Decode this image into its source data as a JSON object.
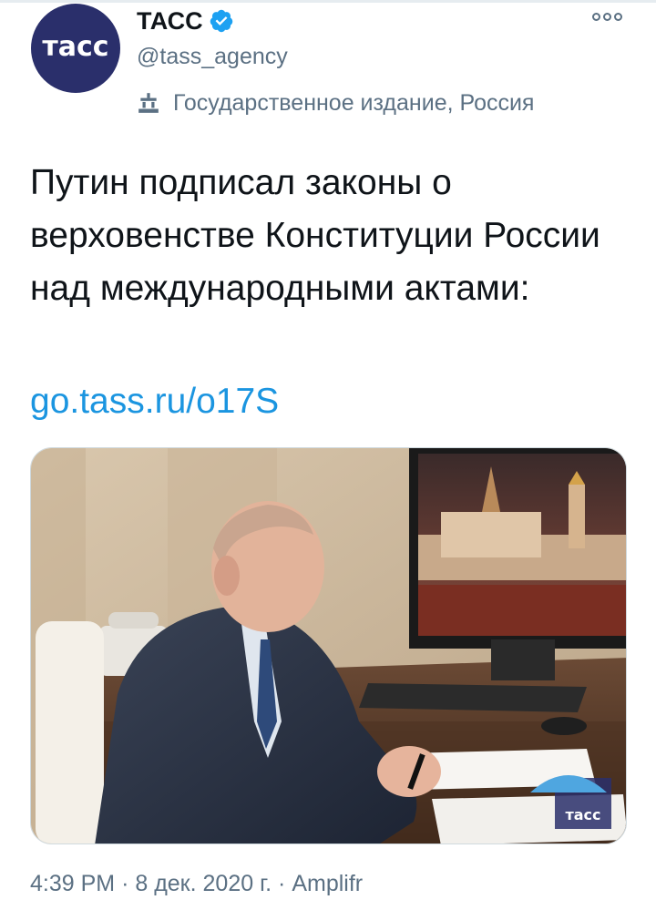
{
  "account": {
    "avatar_text": "тасс",
    "name": "ТАСС",
    "handle": "@tass_agency",
    "label": "Государственное издание, Россия"
  },
  "tweet": {
    "text": "Путин подписал законы о верховенстве Конституции России над международными актами:",
    "link": "go.tass.ru/o17S",
    "watermark": "тасс"
  },
  "meta": {
    "time": "4:39 PM",
    "separator": "·",
    "date": "8 дек. 2020 г.",
    "source": "Amplifr"
  },
  "colors": {
    "verified": "#1da1f2",
    "link": "#1b95e0",
    "muted": "#5b7083",
    "avatar_bg": "#2a2f6b"
  },
  "icons": [
    "verified-badge-icon",
    "government-building-icon",
    "more-options-icon"
  ]
}
